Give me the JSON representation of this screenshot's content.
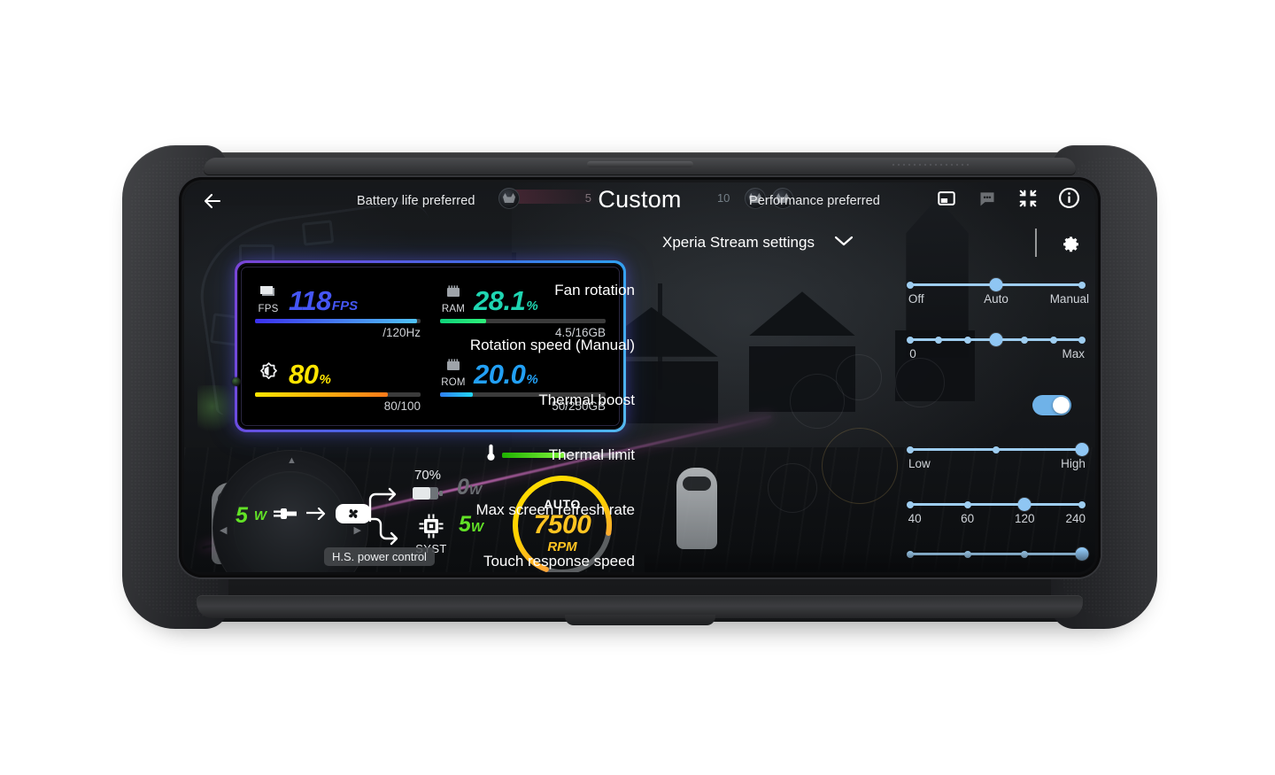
{
  "topbar": {
    "back_icon": "arrow-left-icon",
    "mode_left": "Battery life preferred",
    "mode_title": "Custom",
    "mode_right": "Performance preferred",
    "icons": [
      {
        "name": "picture-in-picture-icon",
        "label": "Picture in picture"
      },
      {
        "name": "chat-bubble-icon",
        "label": "Chat"
      },
      {
        "name": "collapse-icon",
        "label": "Collapse"
      },
      {
        "name": "info-icon",
        "label": "Info"
      }
    ]
  },
  "stats": {
    "cells": [
      {
        "key": "fps",
        "icon_label": "FPS",
        "icon_name": "frames-icon",
        "value": "118",
        "unit": "FPS",
        "sub": "/120Hz",
        "bar_percent": 98,
        "color": "#4556f5"
      },
      {
        "key": "ram",
        "icon_label": "RAM",
        "icon_name": "memory-chip-icon",
        "value": "28.1",
        "unit": "%",
        "sub": "4.5/16GB",
        "bar_percent": 28,
        "color": "#1fd6b2"
      },
      {
        "key": "brightness",
        "icon_label": "",
        "icon_name": "brightness-icon",
        "value": "80",
        "unit": "%",
        "sub": "80/100",
        "bar_percent": 80,
        "color": "#ffe500"
      },
      {
        "key": "rom",
        "icon_label": "ROM",
        "icon_name": "storage-chip-icon",
        "value": "20.0",
        "unit": "%",
        "sub": "50/250GB",
        "bar_percent": 20,
        "color": "#22a0f5"
      }
    ]
  },
  "power": {
    "input_watts": "5",
    "input_unit": "W",
    "plug_icon": "power-plug-icon",
    "arrow_icon": "arrow-right-icon",
    "fan_icon": "fan-icon",
    "battery_percent": "70%",
    "battery_icon": "battery-icon",
    "battery_watts": "0",
    "battery_watts_unit": "W",
    "system_label": "SYST",
    "system_icon": "cpu-chip-icon",
    "system_watts": "5",
    "system_watts_unit": "W",
    "chip_label": "H.S. power control",
    "thermometer_icon": "thermometer-icon",
    "thermal_percent": 52,
    "gauge": {
      "mode": "AUTO",
      "rpm_value": "7500",
      "rpm_unit": "RPM",
      "fill_percent": 72
    }
  },
  "settings": {
    "header": "Xperia Stream settings",
    "chevron_icon": "chevron-down-icon",
    "gear_icon": "gear-icon",
    "rows": [
      {
        "label": "Fan rotation",
        "type": "slider",
        "ticks": 3,
        "selected": 1,
        "labels": [
          {
            "text": "Off",
            "pos": 0
          },
          {
            "text": "Auto",
            "pos": 50
          },
          {
            "text": "Manual",
            "pos": 100
          }
        ]
      },
      {
        "label": "Rotation speed (Manual)",
        "type": "slider",
        "ticks": 7,
        "selected": 3,
        "labels": [
          {
            "text": "0",
            "pos": 0
          },
          {
            "text": "Max",
            "pos": 100
          }
        ]
      },
      {
        "label": "Thermal boost",
        "type": "toggle",
        "value": "on"
      },
      {
        "label": "Thermal limit",
        "type": "slider",
        "ticks": 3,
        "selected": 2,
        "labels": [
          {
            "text": "Low",
            "pos": 0
          },
          {
            "text": "High",
            "pos": 100
          }
        ]
      },
      {
        "label": "Max screen refresh rate",
        "type": "slider",
        "ticks": 4,
        "selected": 2,
        "labels": [
          {
            "text": "40",
            "pos": 0
          },
          {
            "text": "60",
            "pos": 33.3
          },
          {
            "text": "120",
            "pos": 66.6
          },
          {
            "text": "240",
            "pos": 100
          }
        ]
      },
      {
        "label": "Touch response speed",
        "type": "slider",
        "ticks": 4,
        "selected": 3,
        "labels": []
      }
    ]
  },
  "colors": {
    "accent_slider": "#9ecdf0",
    "toggle_on": "#6fb2e8",
    "gauge_fill": "#ffc421",
    "power_green": "#62e226"
  }
}
